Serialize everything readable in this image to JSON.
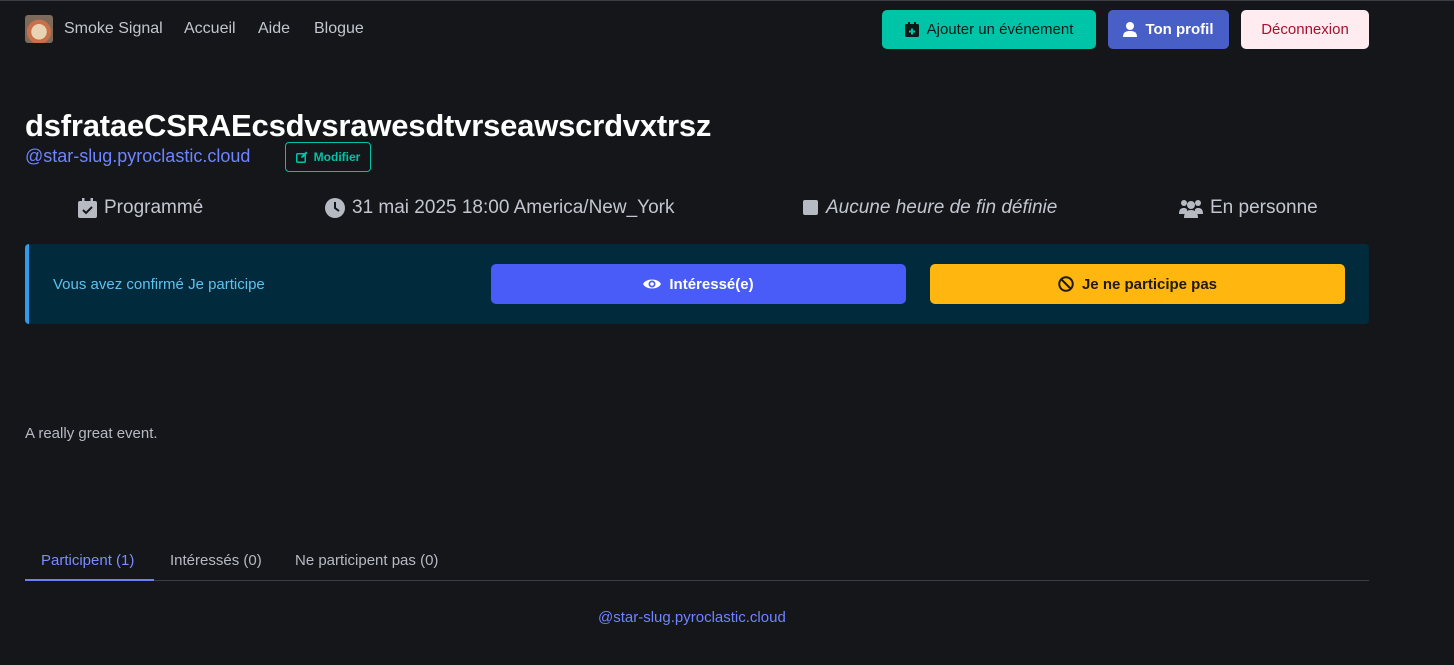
{
  "nav": {
    "brand": "Smoke Signal",
    "links": [
      "Accueil",
      "Aide",
      "Blogue"
    ],
    "add_event": "Ajouter un événement",
    "profile": "Ton profil",
    "logout": "Déconnexion"
  },
  "event": {
    "title": "dsfrataeCSRAEcsdvsrawesdtvrseawscrdvxtrsz",
    "handle": "@star-slug.pyroclastic.cloud",
    "edit_label": "Modifier",
    "status": "Programmé",
    "start": "31 mai 2025 18:00 America/New_York",
    "end": "Aucune heure de fin définie",
    "mode": "En personne",
    "description": "A really great event."
  },
  "rsvp": {
    "message": "Vous avez confirmé Je participe",
    "interested_label": "Intéressé(e)",
    "not_going_label": "Je ne participe pas"
  },
  "tabs": [
    {
      "label": "Participent (1)",
      "active": true
    },
    {
      "label": "Intéressés (0)",
      "active": false
    },
    {
      "label": "Ne participent pas (0)",
      "active": false
    }
  ],
  "attendees": [
    "@star-slug.pyroclastic.cloud"
  ],
  "colors": {
    "background": "#14161a",
    "primary": "#00c4a7",
    "link": "#485fc7",
    "warning": "#ffb70f",
    "info_bg": "#012a3d"
  }
}
